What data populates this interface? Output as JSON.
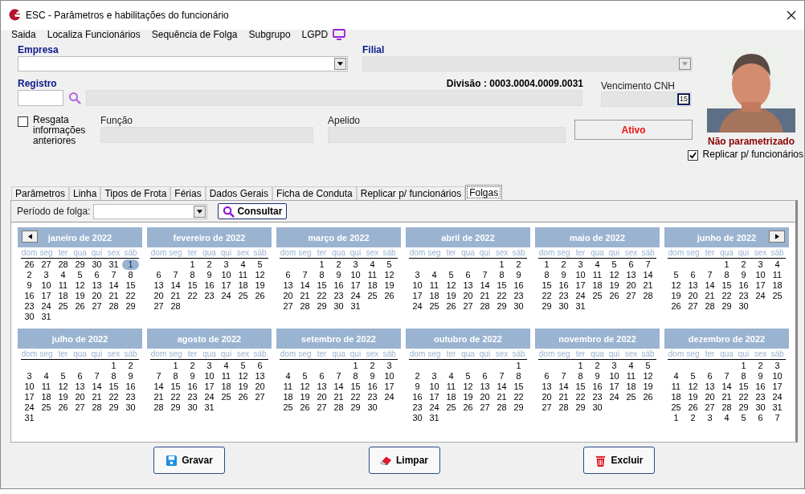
{
  "window": {
    "title": "ESC - Parâmetros e habilitações do funcionário"
  },
  "menu": [
    {
      "label": "Saida"
    },
    {
      "label": "Localiza Funcionários"
    },
    {
      "label": "Sequência de Folga"
    },
    {
      "label": "Subgrupo"
    },
    {
      "label": "LGPD"
    }
  ],
  "form": {
    "empresa": {
      "label": "Empresa",
      "disabled": false
    },
    "filial": {
      "label": "Filial",
      "disabled": true
    },
    "registro": {
      "label": "Registro",
      "code": {
        "disabled": false
      },
      "name": {
        "disabled": true
      }
    },
    "divisao": "Divisão : 0003.0004.0009.0031",
    "cnh": {
      "label": "Vencimento  CNH",
      "disabled": true,
      "calendar_key": "15"
    },
    "resgata": {
      "label": "Resgata informações anteriores",
      "checked": false
    },
    "funcao": {
      "label": "Função",
      "disabled": true
    },
    "apelido": {
      "label": "Apelido",
      "disabled": true
    },
    "status": "Ativo",
    "photo_status": "Não parametrizado",
    "replicar": {
      "label": "Replicar p/ funcionários",
      "checked": true
    }
  },
  "tabs": [
    {
      "label": "Parâmetros",
      "selected": false
    },
    {
      "label": "Linha",
      "selected": false
    },
    {
      "label": "Tipos de Frota",
      "selected": false
    },
    {
      "label": "Férias",
      "selected": false
    },
    {
      "label": "Dados Gerais",
      "selected": false
    },
    {
      "label": "Ficha de Conduta",
      "selected": false
    },
    {
      "label": "Replicar p/ funcionários",
      "selected": false
    },
    {
      "label": "Folgas",
      "selected": true
    }
  ],
  "periodo": {
    "label": "Período de folga:"
  },
  "consultar": "Consultar",
  "months": [
    {
      "title": "janeiro de 2022",
      "prev_button": true,
      "weekdays": [
        "dom",
        "seg",
        "ter",
        "qua",
        "qui",
        "sex",
        "sáb"
      ],
      "weeks": [
        {
          "sun": "26",
          "mon": "27",
          "tue": "28",
          "wed": "29",
          "thu": "30",
          "fri": "31",
          "sat": {
            "text": "1",
            "selected": true
          }
        },
        {
          "sun": "2",
          "mon": "3",
          "tue": "4",
          "wed": "5",
          "thu": "6",
          "fri": "7",
          "sat": "8"
        },
        {
          "sun": "9",
          "mon": "10",
          "tue": "11",
          "wed": "12",
          "thu": "13",
          "fri": "14",
          "sat": "15"
        },
        {
          "sun": "16",
          "mon": "17",
          "tue": "18",
          "wed": "19",
          "thu": "20",
          "fri": "21",
          "sat": "22"
        },
        {
          "sun": "23",
          "mon": "24",
          "tue": "25",
          "wed": "26",
          "thu": "27",
          "fri": "28",
          "sat": "29"
        },
        {
          "sun": "30",
          "mon": "31"
        }
      ]
    },
    {
      "title": "fevereiro de 2022",
      "weekdays": [
        "dom",
        "seg",
        "ter",
        "qua",
        "qui",
        "sex",
        "sáb"
      ],
      "weeks": [
        {
          "tue": "1",
          "wed": "2",
          "thu": "3",
          "fri": "4",
          "sat": "5"
        },
        {
          "sun": "6",
          "mon": "7",
          "tue": "8",
          "wed": "9",
          "thu": "10",
          "fri": "11",
          "sat": "12"
        },
        {
          "sun": "13",
          "mon": "14",
          "tue": "15",
          "wed": "16",
          "thu": "17",
          "fri": "18",
          "sat": "19"
        },
        {
          "sun": "20",
          "mon": "21",
          "tue": "22",
          "wed": "23",
          "thu": "24",
          "fri": "25",
          "sat": "26"
        },
        {
          "sun": "27",
          "mon": "28"
        }
      ]
    },
    {
      "title": "março de 2022",
      "weekdays": [
        "dom",
        "seg",
        "ter",
        "qua",
        "qui",
        "sex",
        "sáb"
      ],
      "weeks": [
        {
          "tue": "1",
          "wed": "2",
          "thu": "3",
          "fri": "4",
          "sat": "5"
        },
        {
          "sun": "6",
          "mon": "7",
          "tue": "8",
          "wed": "9",
          "thu": "10",
          "fri": "11",
          "sat": "12"
        },
        {
          "sun": "13",
          "mon": "14",
          "tue": "15",
          "wed": "16",
          "thu": "17",
          "fri": "18",
          "sat": "19"
        },
        {
          "sun": "20",
          "mon": "21",
          "tue": "22",
          "wed": "23",
          "thu": "24",
          "fri": "25",
          "sat": "26"
        },
        {
          "sun": "27",
          "mon": "28",
          "tue": "29",
          "wed": "30",
          "thu": "31"
        }
      ]
    },
    {
      "title": "abril de 2022",
      "weekdays": [
        "dom",
        "seg",
        "ter",
        "qua",
        "qui",
        "sex",
        "sáb"
      ],
      "weeks": [
        {
          "fri": "1",
          "sat": "2"
        },
        {
          "sun": "3",
          "mon": "4",
          "tue": "5",
          "wed": "6",
          "thu": "7",
          "fri": "8",
          "sat": "9"
        },
        {
          "sun": "10",
          "mon": "11",
          "tue": "12",
          "wed": "13",
          "thu": "14",
          "fri": "15",
          "sat": "16"
        },
        {
          "sun": "17",
          "mon": "18",
          "tue": "19",
          "wed": "20",
          "thu": "21",
          "fri": "22",
          "sat": "23"
        },
        {
          "sun": "24",
          "mon": "25",
          "tue": "26",
          "wed": "27",
          "thu": "28",
          "fri": "29",
          "sat": "30"
        }
      ]
    },
    {
      "title": "maio de 2022",
      "weekdays": [
        "dom",
        "seg",
        "ter",
        "qua",
        "qui",
        "sex",
        "sáb"
      ],
      "weeks": [
        {
          "sun": "1",
          "mon": "2",
          "tue": "3",
          "wed": "4",
          "thu": "5",
          "fri": "6",
          "sat": "7"
        },
        {
          "sun": "8",
          "mon": "9",
          "tue": "10",
          "wed": "11",
          "thu": "12",
          "fri": "13",
          "sat": "14"
        },
        {
          "sun": "15",
          "mon": "16",
          "tue": "17",
          "wed": "18",
          "thu": "19",
          "fri": "20",
          "sat": "21"
        },
        {
          "sun": "22",
          "mon": "23",
          "tue": "24",
          "wed": "25",
          "thu": "26",
          "fri": "27",
          "sat": "28"
        },
        {
          "sun": "29",
          "mon": "30",
          "tue": "31"
        }
      ]
    },
    {
      "title": "junho de 2022",
      "next_button": true,
      "weekdays": [
        "dom",
        "seg",
        "ter",
        "qua",
        "qui",
        "sex",
        "sáb"
      ],
      "weeks": [
        {
          "wed": "1",
          "thu": "2",
          "fri": "3",
          "sat": "4"
        },
        {
          "sun": "5",
          "mon": "6",
          "tue": "7",
          "wed": "8",
          "thu": "9",
          "fri": "10",
          "sat": "11"
        },
        {
          "sun": "12",
          "mon": "13",
          "tue": "14",
          "wed": "15",
          "thu": "16",
          "fri": "17",
          "sat": "18"
        },
        {
          "sun": "19",
          "mon": "20",
          "tue": "21",
          "wed": "22",
          "thu": "23",
          "fri": "24",
          "sat": "25"
        },
        {
          "sun": "26",
          "mon": "27",
          "tue": "28",
          "wed": "29",
          "thu": "30"
        }
      ]
    },
    {
      "title": "julho de 2022",
      "weekdays": [
        "dom",
        "seg",
        "ter",
        "qua",
        "qui",
        "sex",
        "sáb"
      ],
      "weeks": [
        {
          "fri": "1",
          "sat": "2"
        },
        {
          "sun": "3",
          "mon": "4",
          "tue": "5",
          "wed": "6",
          "thu": "7",
          "fri": "8",
          "sat": "9"
        },
        {
          "sun": "10",
          "mon": "11",
          "tue": "12",
          "wed": "13",
          "thu": "14",
          "fri": "15",
          "sat": "16"
        },
        {
          "sun": "17",
          "mon": "18",
          "tue": "19",
          "wed": "20",
          "thu": "21",
          "fri": "22",
          "sat": "23"
        },
        {
          "sun": "24",
          "mon": "25",
          "tue": "26",
          "wed": "27",
          "thu": "28",
          "fri": "29",
          "sat": "30"
        },
        {
          "sun": "31"
        }
      ]
    },
    {
      "title": "agosto de 2022",
      "weekdays": [
        "dom",
        "seg",
        "ter",
        "qua",
        "qui",
        "sex",
        "sáb"
      ],
      "weeks": [
        {
          "mon": "1",
          "tue": "2",
          "wed": "3",
          "thu": "4",
          "fri": "5",
          "sat": "6"
        },
        {
          "sun": "7",
          "mon": "8",
          "tue": "9",
          "wed": "10",
          "thu": "11",
          "fri": "12",
          "sat": "13"
        },
        {
          "sun": "14",
          "mon": "15",
          "tue": "16",
          "wed": "17",
          "thu": "18",
          "fri": "19",
          "sat": "20"
        },
        {
          "sun": "21",
          "mon": "22",
          "tue": "23",
          "wed": "24",
          "thu": "25",
          "fri": "26",
          "sat": "27"
        },
        {
          "sun": "28",
          "mon": "29",
          "tue": "30",
          "wed": "31"
        }
      ]
    },
    {
      "title": "setembro de 2022",
      "weekdays": [
        "dom",
        "seg",
        "ter",
        "qua",
        "qui",
        "sex",
        "sáb"
      ],
      "weeks": [
        {
          "thu": "1",
          "fri": "2",
          "sat": "3"
        },
        {
          "sun": "4",
          "mon": "5",
          "tue": "6",
          "wed": "7",
          "thu": "8",
          "fri": "9",
          "sat": "10"
        },
        {
          "sun": "11",
          "mon": "12",
          "tue": "13",
          "wed": "14",
          "thu": "15",
          "fri": "16",
          "sat": "17"
        },
        {
          "sun": "18",
          "mon": "19",
          "tue": "20",
          "wed": "21",
          "thu": "22",
          "fri": "23",
          "sat": "24"
        },
        {
          "sun": "25",
          "mon": "26",
          "tue": "27",
          "wed": "28",
          "thu": "29",
          "fri": "30"
        }
      ]
    },
    {
      "title": "outubro de 2022",
      "weekdays": [
        "dom",
        "seg",
        "ter",
        "qua",
        "qui",
        "sex",
        "sáb"
      ],
      "weeks": [
        {
          "sat": "1"
        },
        {
          "sun": "2",
          "mon": "3",
          "tue": "4",
          "wed": "5",
          "thu": "6",
          "fri": "7",
          "sat": "8"
        },
        {
          "sun": "9",
          "mon": "10",
          "tue": "11",
          "wed": "12",
          "thu": "13",
          "fri": "14",
          "sat": "15"
        },
        {
          "sun": "16",
          "mon": "17",
          "tue": "18",
          "wed": "19",
          "thu": "20",
          "fri": "21",
          "sat": "22"
        },
        {
          "sun": "23",
          "mon": "24",
          "tue": "25",
          "wed": "26",
          "thu": "27",
          "fri": "28",
          "sat": "29"
        },
        {
          "sun": "30",
          "mon": "31"
        }
      ]
    },
    {
      "title": "novembro de 2022",
      "weekdays": [
        "dom",
        "seg",
        "ter",
        "qua",
        "qui",
        "sex",
        "sáb"
      ],
      "weeks": [
        {
          "tue": "1",
          "wed": "2",
          "thu": "3",
          "fri": "4",
          "sat": "5"
        },
        {
          "sun": "6",
          "mon": "7",
          "tue": "8",
          "wed": "9",
          "thu": "10",
          "fri": "11",
          "sat": "12"
        },
        {
          "sun": "13",
          "mon": "14",
          "tue": "15",
          "wed": "16",
          "thu": "17",
          "fri": "18",
          "sat": "19"
        },
        {
          "sun": "20",
          "mon": "21",
          "tue": "22",
          "wed": "23",
          "thu": "24",
          "fri": "25",
          "sat": "26"
        },
        {
          "sun": "27",
          "mon": "28",
          "tue": "29",
          "wed": "30"
        }
      ]
    },
    {
      "title": "dezembro de 2022",
      "weekdays": [
        "dom",
        "seg",
        "ter",
        "qua",
        "qui",
        "sex",
        "sáb"
      ],
      "weeks": [
        {
          "thu": "1",
          "fri": "2",
          "sat": "3"
        },
        {
          "sun": "4",
          "mon": "5",
          "tue": "6",
          "wed": "7",
          "thu": "8",
          "fri": "9",
          "sat": "10"
        },
        {
          "sun": "11",
          "mon": "12",
          "tue": "13",
          "wed": "14",
          "thu": "15",
          "fri": "16",
          "sat": "17"
        },
        {
          "sun": "18",
          "mon": "19",
          "tue": "20",
          "wed": "21",
          "thu": "22",
          "fri": "23",
          "sat": "24"
        },
        {
          "sun": "25",
          "mon": "26",
          "tue": "27",
          "wed": "28",
          "thu": "29",
          "fri": "30",
          "sat": "31"
        },
        {
          "sun": "1",
          "mon": "2",
          "tue": "3",
          "wed": "4",
          "thu": "5",
          "fri": "6",
          "sat": "7"
        }
      ]
    }
  ],
  "buttons": [
    {
      "label": "Gravar",
      "kind": "save"
    },
    {
      "label": "Limpar",
      "kind": "clear"
    },
    {
      "label": "Excluir",
      "kind": "delete"
    }
  ]
}
